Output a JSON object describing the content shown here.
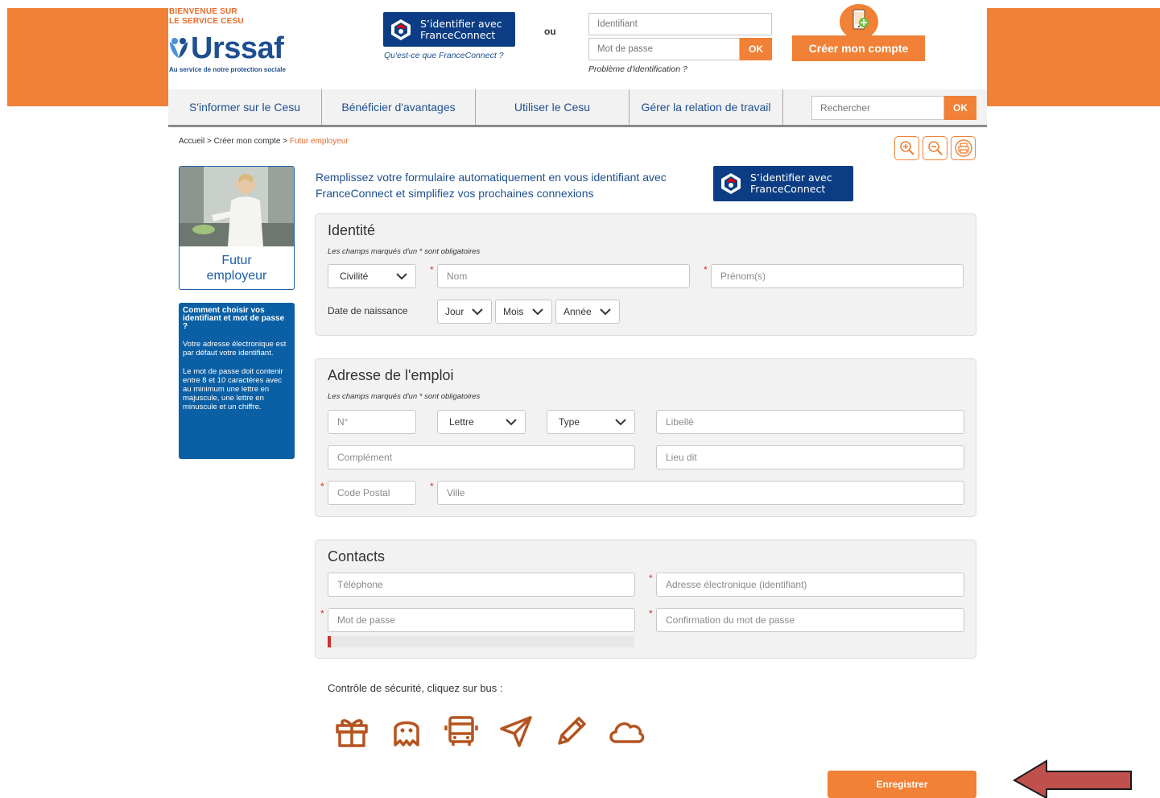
{
  "header": {
    "welcome_line1": "BIENVENUE SUR",
    "welcome_line2": "LE SERVICE CESU",
    "logo_text": "Urssaf",
    "logo_tagline": "Au service de notre protection sociale",
    "franceconnect_line1": "S’identifier avec",
    "franceconnect_line2": "FranceConnect",
    "franceconnect_link": "Qu'est-ce que FranceConnect ?",
    "or_text": "ou",
    "identifiant_placeholder": "Identifiant",
    "password_placeholder": "Mot de passe",
    "ok_label": "OK",
    "problem_link": "Problème d'identification ?",
    "create_account_label": "Créer mon compte"
  },
  "nav": {
    "items": [
      "S'informer sur le Cesu",
      "Bénéficier d'avantages",
      "Utiliser le Cesu",
      "Gérer la relation de travail"
    ],
    "search_placeholder": "Rechercher",
    "search_ok": "OK"
  },
  "breadcrumb": {
    "home": "Accueil",
    "sep": ">",
    "parent": "Créer mon compte",
    "current": "Futur employeur"
  },
  "sidebar": {
    "card_caption_line1": "Futur",
    "card_caption_line2": "employeur",
    "help_title": "Comment choisir vos identifiant et mot de passe ?",
    "help_p1": "Votre adresse électronique est par défaut votre identifiant.",
    "help_p2": "Le mot de passe doit contenir entre 8 et 10 caractères avec au minimum une lettre en majuscule, une lettre en minuscule et un chiffre."
  },
  "intro": {
    "text_line1": "Remplissez votre formulaire automatiquement en vous identifiant avec",
    "text_line2": "FranceConnect et simplifiez vos prochaines connexions",
    "fc_line1": "S’identifier avec",
    "fc_line2": "FranceConnect"
  },
  "identity": {
    "title": "Identité",
    "note": "Les champs marqués d'un * sont obligatoires",
    "civilite": "Civilité",
    "nom_placeholder": "Nom",
    "prenom_placeholder": "Prénom(s)",
    "birth_label": "Date de naissance",
    "day": "Jour",
    "month": "Mois",
    "year": "Année",
    "required_mark": "*"
  },
  "address": {
    "title": "Adresse de l'emploi",
    "note": "Les champs marqués d'un * sont obligatoires",
    "number_placeholder": "N°",
    "letter": "Lettre",
    "type": "Type",
    "libelle_placeholder": "Libellé",
    "complement_placeholder": "Complément",
    "lieu_dit_placeholder": "Lieu dit",
    "postal_placeholder": "Code Postal",
    "city_placeholder": "Ville",
    "required_mark": "*"
  },
  "contacts": {
    "title": "Contacts",
    "phone_placeholder": "Téléphone",
    "email_placeholder": "Adresse électronique (identifiant)",
    "password_placeholder": "Mot de passe",
    "confirm_placeholder": "Confirmation du mot de passe",
    "password_strength": 0.01,
    "required_mark": "*"
  },
  "captcha": {
    "label": "Contrôle de sécurité, cliquez sur bus :",
    "icons": [
      "gift-icon",
      "ghost-icon",
      "bus-icon",
      "paper-plane-icon",
      "pencil-icon",
      "cloud-icon"
    ]
  },
  "save_label": "Enregistrer",
  "colors": {
    "accent": "#f08136",
    "brand_blue": "#1d4f91",
    "franceconnect_blue": "#0c3d84",
    "help_blue": "#0b5fa5",
    "required_red": "#d0322c",
    "arrow_red": "#c0504d",
    "captcha_brown": "#b5531e"
  }
}
